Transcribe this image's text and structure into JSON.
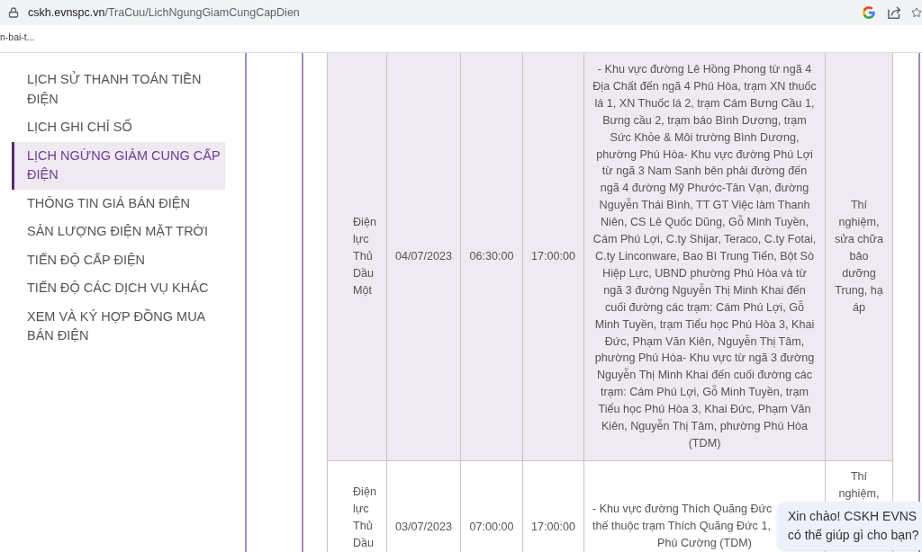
{
  "browser": {
    "url_host": "cskh.evnspc.vn",
    "url_path": "/TraCuu/LichNgungGiamCungCapDien",
    "bookmark": "n-bai-t..."
  },
  "sidebar": {
    "items": [
      {
        "label": "LỊCH SỬ THANH TOÁN TIỀN ĐIỆN",
        "selected": false
      },
      {
        "label": "LỊCH GHI CHỈ SỐ",
        "selected": false
      },
      {
        "label": "LỊCH NGỪNG GIẢM CUNG CẤP ĐIỆN",
        "selected": true
      },
      {
        "label": "THÔNG TIN GIÁ BÁN ĐIỆN",
        "selected": false
      },
      {
        "label": "SẢN LƯỢNG ĐIỆN MẶT TRỜI",
        "selected": false
      },
      {
        "label": "TIẾN ĐỘ CẤP ĐIỆN",
        "selected": false
      },
      {
        "label": "TIẾN ĐỘ CÁC DỊCH VỤ KHÁC",
        "selected": false
      },
      {
        "label": "XEM VÀ KÝ HỢP ĐỒNG MUA BÁN ĐIỆN",
        "selected": false
      }
    ]
  },
  "table": {
    "rows": [
      {
        "column_1": "Điện lực Thủ Dầu Một",
        "column_2": "04/07/2023",
        "column_3": "06:30:00",
        "column_4": "17:00:00",
        "column_5": [
          "- Khu vực đường Lê Hồng Phong từ ngã 4 Địa Chất đến ngã 4 Phú Hòa, trạm XN thuốc lá 1, XN Thuốc lá 2, trạm Cám Bưng Cầu 1, Bưng cầu 2, trạm báo Bình Dương, trạm Sức Khỏe & Môi trường Bình Dương, phường Phú Hòa- Khu vực đường Phú Lợi từ ngã 3 Nam Sanh bên phải đường đến ngã 4 đường Mỹ Phước-Tân Vạn, đường Nguyễn Thái Bình, TT GT Việc làm Thanh Niên, CS Lê Quốc Dũng, Gỗ Minh Tuyền, Cám Phú Lợi, C.ty Shijar, Teraco, C.ty Fotai, C.ty Linconware, Bao Bì Trung Tiến, Bột Sò Hiệp Lực, UBND phường Phú Hòa và từ ngã 3 đường Nguyễn Thị Minh Khai đến cuối đường các trạm: Cám Phú Lợi, Gỗ Minh Tuyền, trạm Tiểu học Phú Hòa 3, Khai Đức, Phạm Văn Kiên, Nguyễn Thị Tâm, phường Phú Hòa- Khu vực từ ngã 3 đường Nguyễn Thị Minh Khai đến cuối đường các trạm: Cám Phú Lợi, Gỗ Minh Tuyền, trạm Tiểu học Phú Hòa 3, Khai Đức, Phạm Văn Kiên, Nguyễn Thị Tâm, phường Phú Hòa (TDM)"
        ],
        "column_6": "Thí nghiệm, sửa chữa bảo dưỡng Trung, hạ áp"
      },
      {
        "column_1": "Điện lực Thủ Dầu",
        "column_2": "03/07/2023",
        "column_3": "07:00:00",
        "column_4": "17:00:00",
        "column_5": [
          "- Khu vực đường Thích Quãng Đức",
          "thế thuộc trạm Thích Quãng Đức 1,",
          "Phú Cường (TDM)"
        ],
        "column_6": "Thí nghiệm,"
      }
    ]
  },
  "chat_bubble": {
    "lines": [
      "Xin chào! CSKH EVNS",
      "có thể giúp gì cho bạn?"
    ]
  }
}
